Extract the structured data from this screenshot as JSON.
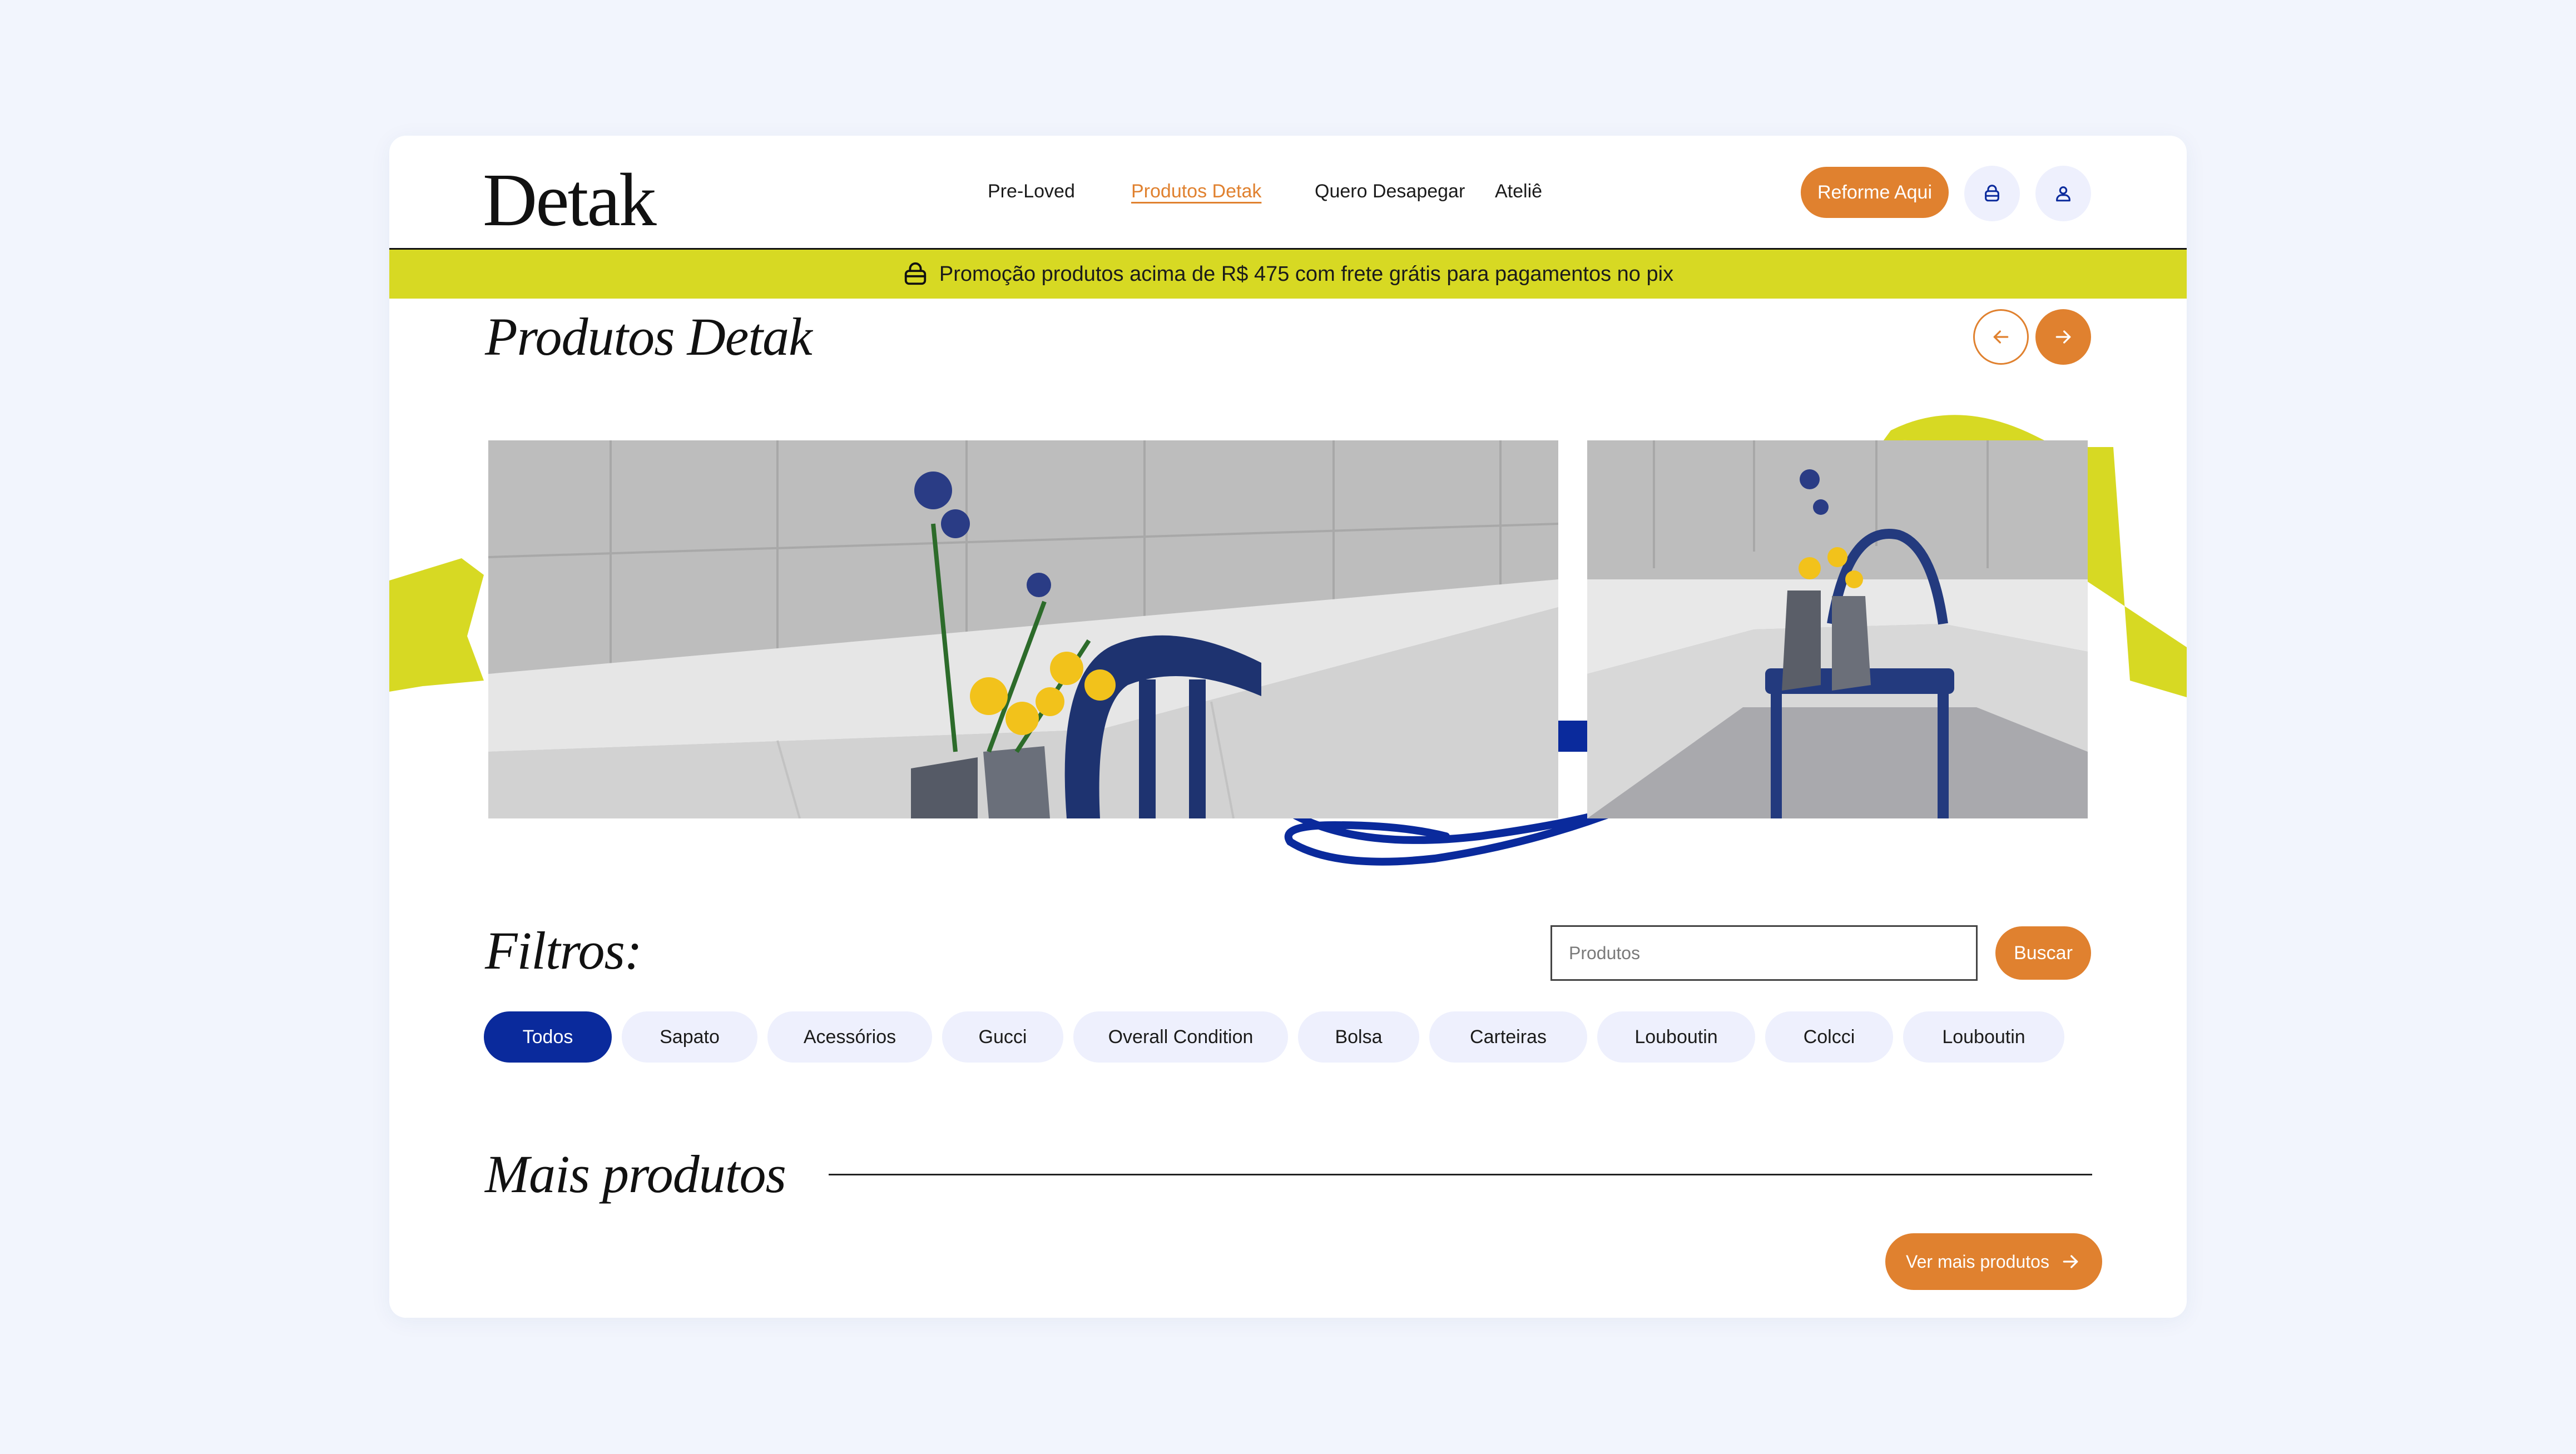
{
  "header": {
    "logo": "Detak",
    "nav": [
      {
        "label": "Pre-Loved"
      },
      {
        "label": "Produtos Detak"
      },
      {
        "label": "Quero Desapegar"
      },
      {
        "label": "Ateliê"
      }
    ],
    "cta_label": "Reforme Aqui",
    "icons": [
      "bag-icon",
      "user-icon"
    ]
  },
  "promo": {
    "text": "Promoção produtos acima de R$ 475 com frete grátis para pagamentos no pix",
    "icon": "shopping-bag-icon"
  },
  "gallery": {
    "title": "Produtos Detak",
    "images": [
      "vase-flowers-blue-chair-photo",
      "chair-boots-flowers-photo"
    ]
  },
  "filters": {
    "title": "Filtros:",
    "search_placeholder": "Produtos",
    "search_button": "Buscar",
    "chips": [
      {
        "label": "Todos",
        "active": true
      },
      {
        "label": "Sapato"
      },
      {
        "label": "Acessórios"
      },
      {
        "label": "Gucci"
      },
      {
        "label": "Overall Condition"
      },
      {
        "label": "Bolsa"
      },
      {
        "label": "Carteiras"
      },
      {
        "label": "Louboutin"
      },
      {
        "label": "Colcci"
      },
      {
        "label": "Louboutin"
      }
    ]
  },
  "more": {
    "title": "Mais produtos",
    "button_label": "Ver mais produtos"
  },
  "colors": {
    "accent": "#e0812f",
    "promo_bg": "#d7d923",
    "chip_active": "#0a2a9c",
    "chip_bg": "#eef0fd",
    "page_bg": "#f2f5fd"
  }
}
